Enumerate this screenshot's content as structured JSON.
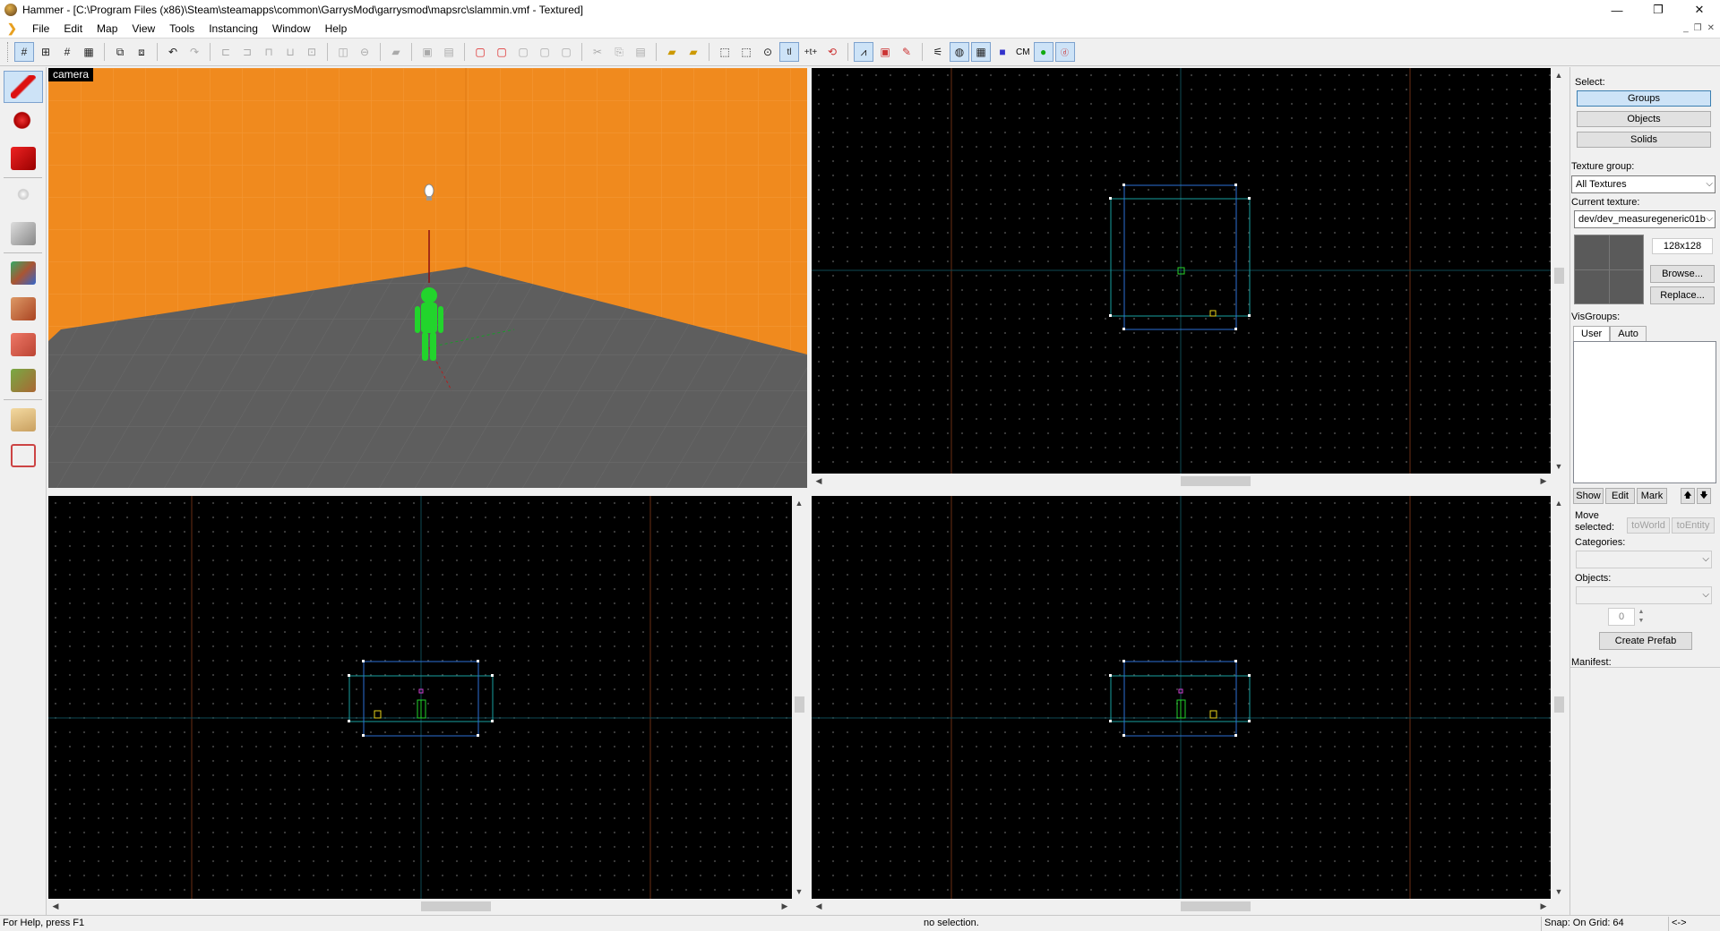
{
  "window": {
    "title": "Hammer - [C:\\Program Files (x86)\\Steam\\steamapps\\common\\GarrysMod\\garrysmod\\mapsrc\\slammin.vmf - Textured]",
    "minimize": "—",
    "maximize": "❐",
    "close": "✕"
  },
  "menu": {
    "items": [
      "File",
      "Edit",
      "Map",
      "View",
      "Tools",
      "Instancing",
      "Window",
      "Help"
    ],
    "mdi_minimize": "_",
    "mdi_restore": "❐",
    "mdi_close": "✕"
  },
  "toolbar": {
    "cm_label": "CM"
  },
  "viewports": {
    "camera_label": "camera"
  },
  "right_panel": {
    "select_label": "Select:",
    "groups_button": "Groups",
    "objects_button": "Objects",
    "solids_button": "Solids",
    "texture_group_label": "Texture group:",
    "texture_group_value": "All Textures",
    "current_texture_label": "Current texture:",
    "current_texture_value": "dev/dev_measuregeneric01b",
    "texture_size": "128x128",
    "browse_button": "Browse...",
    "replace_button": "Replace...",
    "visgroups_label": "VisGroups:",
    "tab_user": "User",
    "tab_auto": "Auto",
    "show_button": "Show",
    "edit_button": "Edit",
    "mark_button": "Mark",
    "up_button": "🡅",
    "down_button": "🡇",
    "move_selected_label": "Move selected:",
    "to_world_button": "toWorld",
    "to_entity_button": "toEntity",
    "categories_label": "Categories:",
    "objects_label": "Objects:",
    "spin_value": "0",
    "create_prefab_button": "Create Prefab",
    "manifest_label": "Manifest:"
  },
  "status": {
    "help": "For Help, press F1",
    "selection": "no selection.",
    "snap": "Snap: On Grid: 64",
    "arrows": "<->"
  },
  "colors": {
    "wall_orange": "#f08a1e",
    "floor_gray": "#5e5e5e",
    "brush_cyan": "#19a0a0",
    "brush_blue": "#2c6fd6",
    "player_green": "#22d42c",
    "selected_button": "#cde3f7"
  }
}
